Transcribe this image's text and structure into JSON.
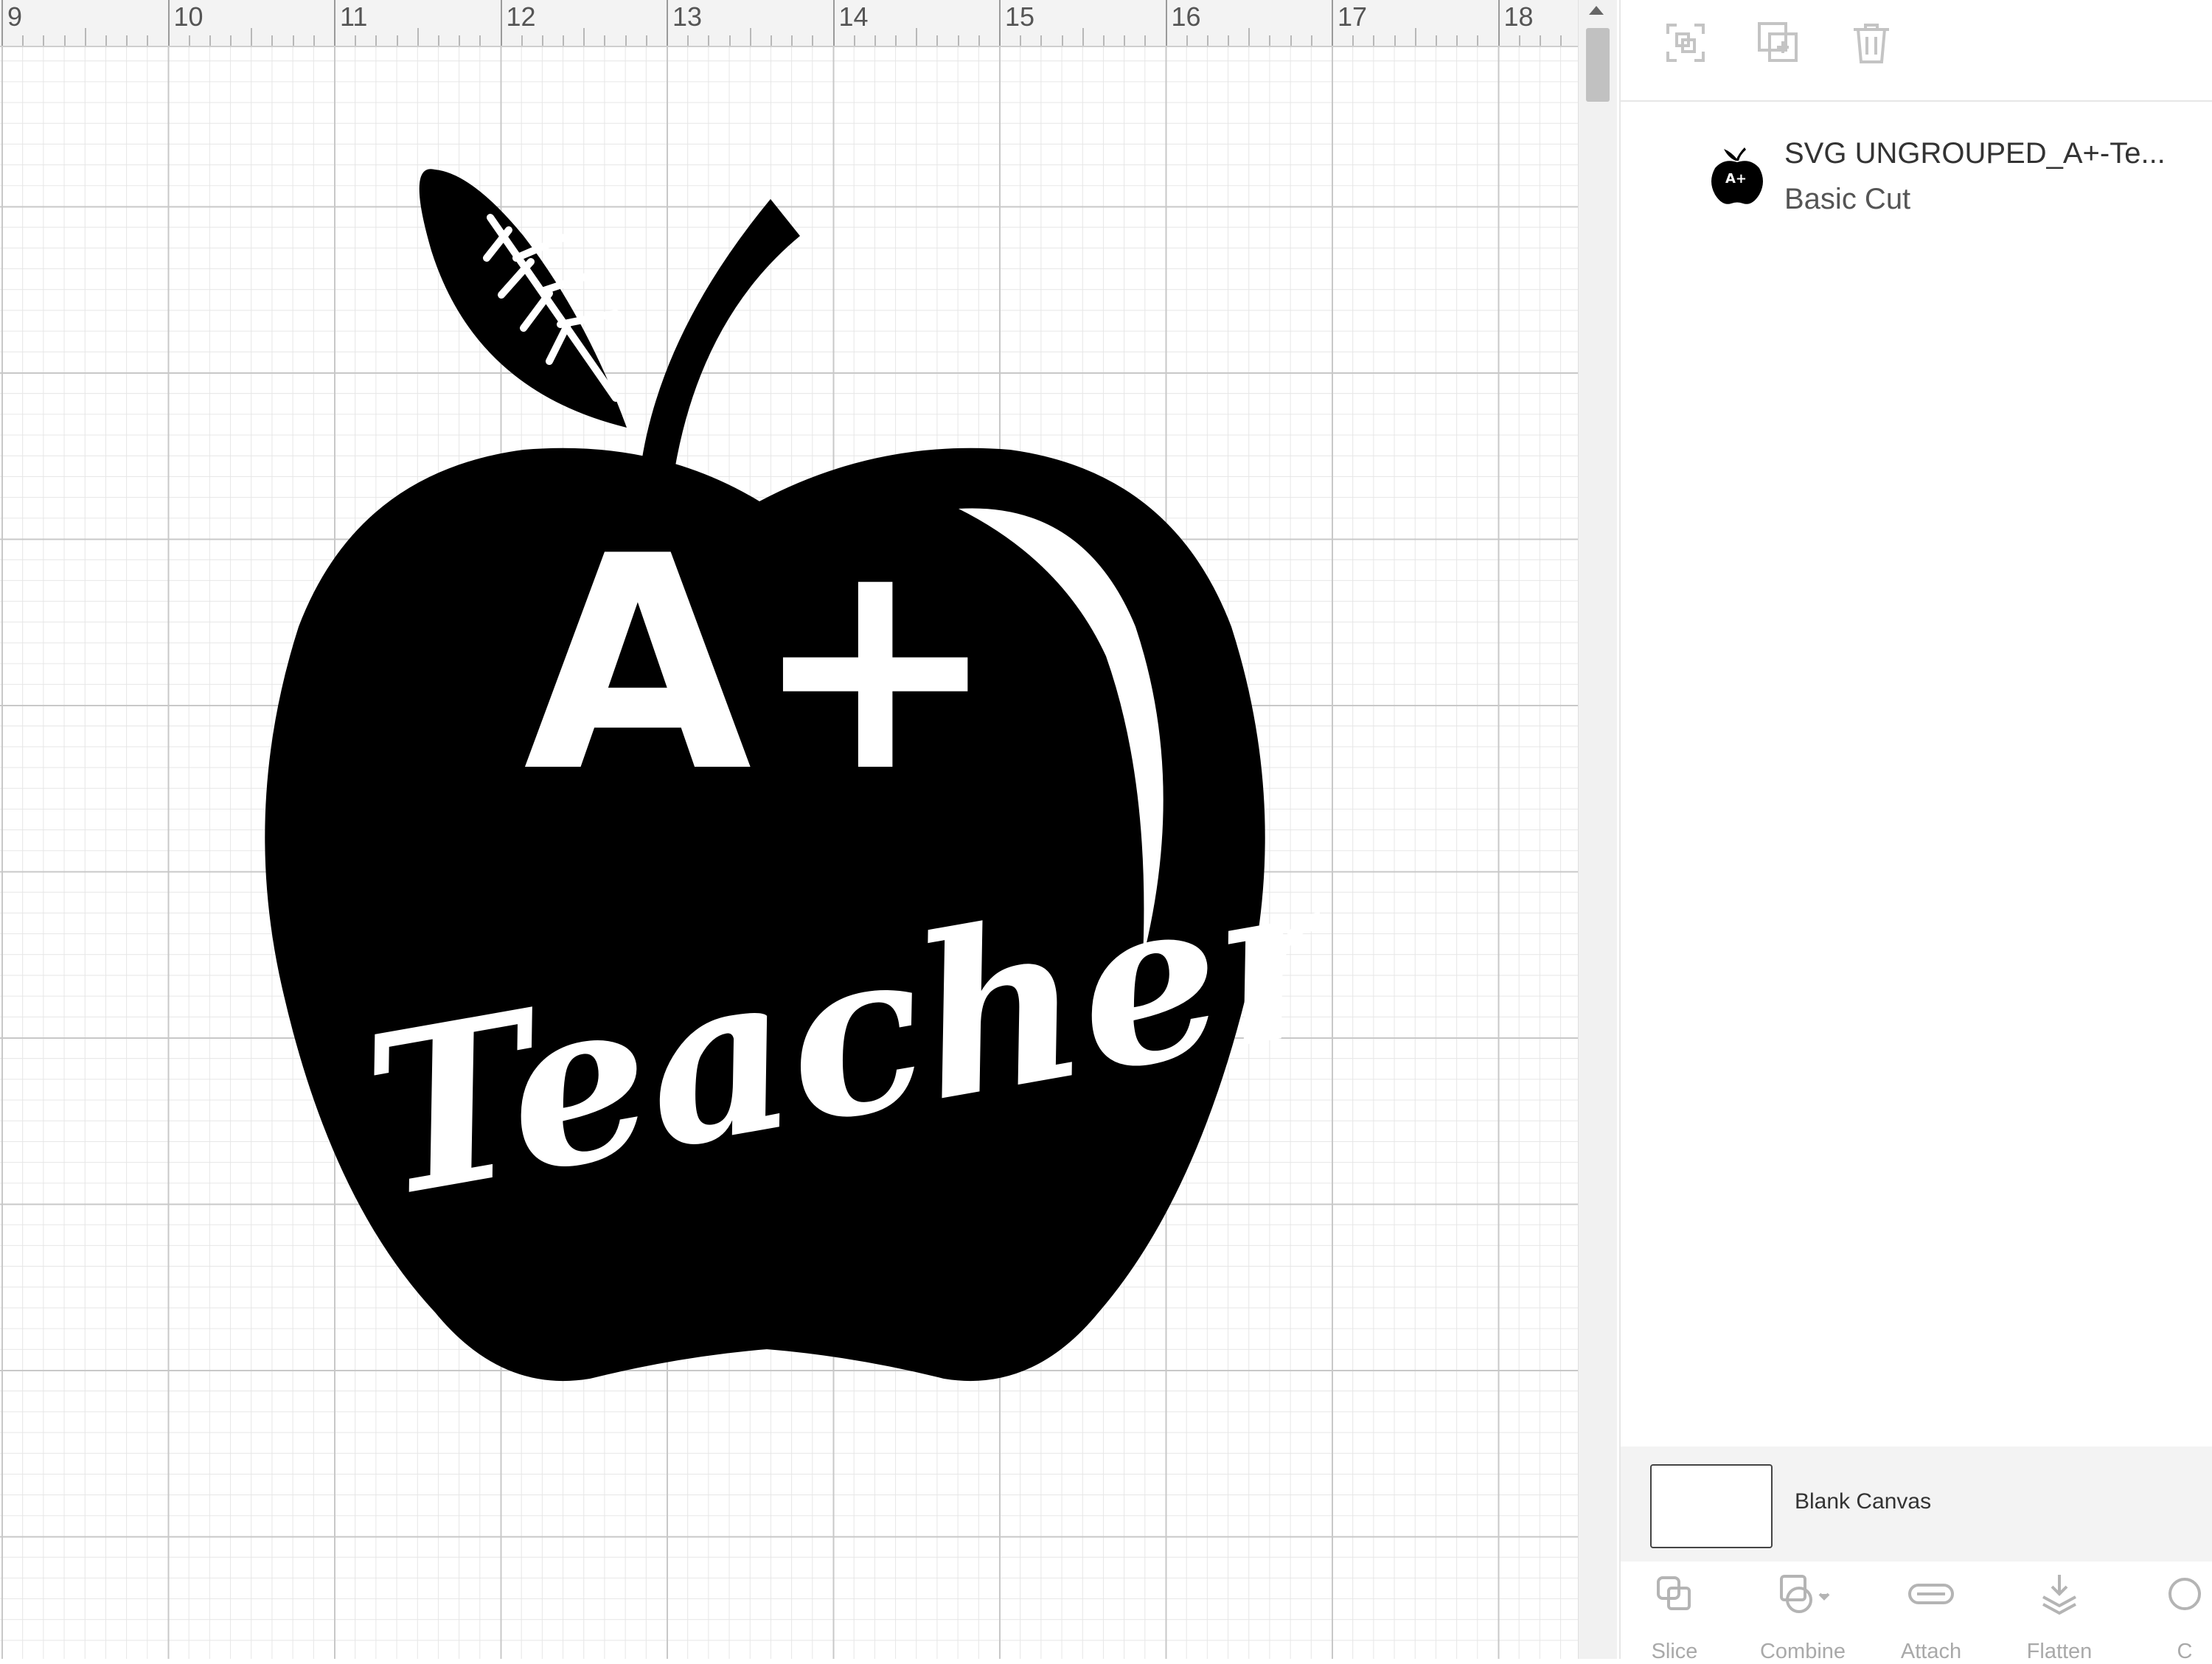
{
  "ruler": {
    "labels": [
      "9",
      "10",
      "11",
      "12",
      "13",
      "14",
      "15",
      "16",
      "17",
      "18"
    ]
  },
  "panel": {
    "toolbar": {
      "group_icon": "group-icon",
      "duplicate_icon": "duplicate-icon",
      "delete_icon": "trash-icon"
    },
    "layer": {
      "name": "SVG UNGROUPED_A+-Te...",
      "type": "Basic Cut"
    },
    "blank_canvas": {
      "label": "Blank Canvas"
    },
    "bottom_tools": [
      {
        "label": "Slice",
        "icon": "slice-icon"
      },
      {
        "label": "Combine",
        "icon": "combine-icon"
      },
      {
        "label": "Attach",
        "icon": "attach-icon"
      },
      {
        "label": "Flatten",
        "icon": "flatten-icon"
      },
      {
        "label": "C",
        "icon": "contour-icon"
      }
    ]
  },
  "artwork": {
    "line1": "A+",
    "line2": "Teacher",
    "fill": "#000000"
  },
  "colors": {
    "ruler_bg": "#f3f3f3",
    "panel_bg": "#ffffff",
    "disabled": "#a9a9a9"
  }
}
